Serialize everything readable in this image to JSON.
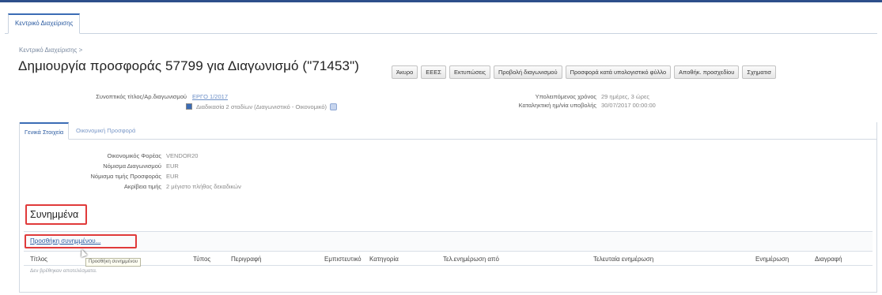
{
  "top_tab": {
    "label": "Κεντρικό Διαχείρισης"
  },
  "breadcrumb": "Κεντρικό Διαχείρισης >",
  "title": "Δημιουργία προσφοράς 57799 για Διαγωνισμό (\"71453\")",
  "toolbar": {
    "buttons": [
      "Άκυρο",
      "ΕΕΕΣ",
      "Εκτυπώσεις",
      "Προβολή διαγωνισμού",
      "Προσφορά κατά υπολογιστικό φύλλο",
      "Αποθήκ. προσχεδίου",
      "Σχηματισ"
    ]
  },
  "meta": {
    "left_label": "Συνοπτικός τίτλος/Αρ.διαγωνισμού",
    "left_value": "ΕΡΓΟ 1/2017",
    "checkbox_text": "Διαδικασία 2 σταδίων (Διαγωνιστικό - Οικονομικό)",
    "right_label1": "Υπολειπόμενος χρόνος",
    "right_value1": "29 ημέρες, 3 ώρες",
    "right_label2": "Καταληκτική ημ/νία υποβολής",
    "right_value2": "30/07/2017 00:00:00"
  },
  "inner_tabs": [
    "Γενικά Στοιχεία",
    "Οικονομική Προσφορά"
  ],
  "fields": [
    {
      "label": "Οικονομικός Φορέας",
      "value": "VENDOR20"
    },
    {
      "label": "Νόμισμα Διαγωνισμού",
      "value": "EUR"
    },
    {
      "label": "Νόμισμα τιμής Προσφοράς",
      "value": "EUR"
    },
    {
      "label": "Ακρίβεια τιμής",
      "value": "2 μέγιστο πλήθος δεκαδικών"
    }
  ],
  "attachments": {
    "section_title": "Συνημμένα",
    "add_button": "Προσθήκη συνημμένου...",
    "tooltip": "Προσθήκη συνημμένου",
    "columns": [
      "Τίτλος",
      "Τύπος",
      "Περιγραφή",
      "Εμπιστευτικό",
      "Κατηγορία",
      "Τελ.ενημέρωση από",
      "Τελευταία ενημέρωση",
      "Ενημέρωση",
      "Διαγραφή"
    ],
    "empty_text": "Δεν βρέθηκαν αποτελέσματα."
  },
  "colors": {
    "highlight": "#e03a3a",
    "accent": "#3b6cb5",
    "link": "#2a5aa0"
  }
}
